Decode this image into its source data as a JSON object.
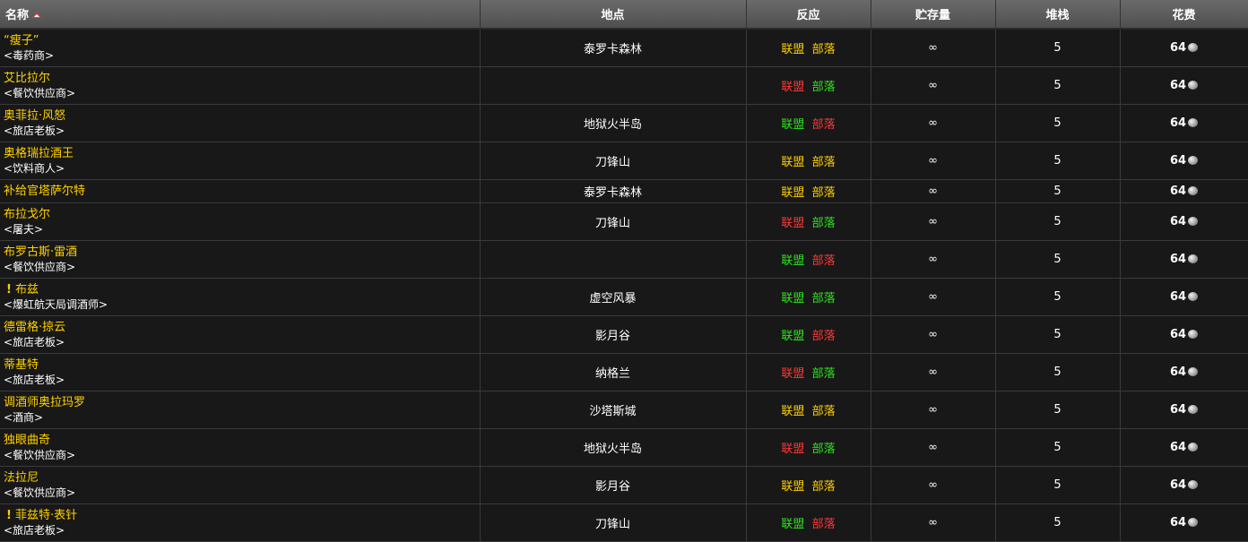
{
  "columns": {
    "name": "名称",
    "location": "地点",
    "react": "反应",
    "stock": "贮存量",
    "stack": "堆栈",
    "cost": "花费"
  },
  "colors": {
    "yellow": "#ffd100",
    "red": "#ff3838",
    "green": "#2ee61e"
  },
  "rows": [
    {
      "name": "“瘦子”",
      "tag": "<毒药商>",
      "location": "泰罗卡森林",
      "a": "联盟",
      "h": "部落",
      "ac": "#ffd100",
      "hc": "#ffd100",
      "stock": "∞",
      "stack": "5",
      "cost": "64",
      "quest": false,
      "tall": true
    },
    {
      "name": "艾比拉尔",
      "tag": "<餐饮供应商>",
      "location": "",
      "a": "联盟",
      "h": "部落",
      "ac": "#ff3838",
      "hc": "#2ee61e",
      "stock": "∞",
      "stack": "5",
      "cost": "64",
      "quest": false,
      "tall": true
    },
    {
      "name": "奥菲拉·风怒",
      "tag": "<旅店老板>",
      "location": "地狱火半岛",
      "a": "联盟",
      "h": "部落",
      "ac": "#2ee61e",
      "hc": "#ff3838",
      "stock": "∞",
      "stack": "5",
      "cost": "64",
      "quest": false,
      "tall": true
    },
    {
      "name": "奥格瑞拉酒王",
      "tag": "<饮料商人>",
      "location": "刀锋山",
      "a": "联盟",
      "h": "部落",
      "ac": "#ffd100",
      "hc": "#ffd100",
      "stock": "∞",
      "stack": "5",
      "cost": "64",
      "quest": false,
      "tall": true
    },
    {
      "name": "补给官塔萨尔特",
      "tag": "",
      "location": "泰罗卡森林",
      "a": "联盟",
      "h": "部落",
      "ac": "#ffd100",
      "hc": "#ffd100",
      "stock": "∞",
      "stack": "5",
      "cost": "64",
      "quest": false,
      "tall": false
    },
    {
      "name": "布拉戈尔",
      "tag": "<屠夫>",
      "location": "刀锋山",
      "a": "联盟",
      "h": "部落",
      "ac": "#ff3838",
      "hc": "#2ee61e",
      "stock": "∞",
      "stack": "5",
      "cost": "64",
      "quest": false,
      "tall": true
    },
    {
      "name": "布罗古斯·雷酒",
      "tag": "<餐饮供应商>",
      "location": "",
      "a": "联盟",
      "h": "部落",
      "ac": "#2ee61e",
      "hc": "#ff3838",
      "stock": "∞",
      "stack": "5",
      "cost": "64",
      "quest": false,
      "tall": true
    },
    {
      "name": "布兹",
      "tag": "<爆虹航天局调酒师>",
      "location": "虚空风暴",
      "a": "联盟",
      "h": "部落",
      "ac": "#2ee61e",
      "hc": "#2ee61e",
      "stock": "∞",
      "stack": "5",
      "cost": "64",
      "quest": true,
      "tall": true
    },
    {
      "name": "德雷格·掠云",
      "tag": "<旅店老板>",
      "location": "影月谷",
      "a": "联盟",
      "h": "部落",
      "ac": "#2ee61e",
      "hc": "#ff3838",
      "stock": "∞",
      "stack": "5",
      "cost": "64",
      "quest": false,
      "tall": true
    },
    {
      "name": "蒂基特",
      "tag": "<旅店老板>",
      "location": "纳格兰",
      "a": "联盟",
      "h": "部落",
      "ac": "#ff3838",
      "hc": "#2ee61e",
      "stock": "∞",
      "stack": "5",
      "cost": "64",
      "quest": false,
      "tall": true
    },
    {
      "name": "调酒师奥拉玛罗",
      "tag": "<酒商>",
      "location": "沙塔斯城",
      "a": "联盟",
      "h": "部落",
      "ac": "#ffd100",
      "hc": "#ffd100",
      "stock": "∞",
      "stack": "5",
      "cost": "64",
      "quest": false,
      "tall": true
    },
    {
      "name": "独眼曲奇",
      "tag": "<餐饮供应商>",
      "location": "地狱火半岛",
      "a": "联盟",
      "h": "部落",
      "ac": "#ff3838",
      "hc": "#2ee61e",
      "stock": "∞",
      "stack": "5",
      "cost": "64",
      "quest": false,
      "tall": true
    },
    {
      "name": "法拉尼",
      "tag": "<餐饮供应商>",
      "location": "影月谷",
      "a": "联盟",
      "h": "部落",
      "ac": "#ffd100",
      "hc": "#ffd100",
      "stock": "∞",
      "stack": "5",
      "cost": "64",
      "quest": false,
      "tall": true
    },
    {
      "name": "菲兹特·表针",
      "tag": "<旅店老板>",
      "location": "刀锋山",
      "a": "联盟",
      "h": "部落",
      "ac": "#2ee61e",
      "hc": "#ff3838",
      "stock": "∞",
      "stack": "5",
      "cost": "64",
      "quest": true,
      "tall": true
    }
  ]
}
